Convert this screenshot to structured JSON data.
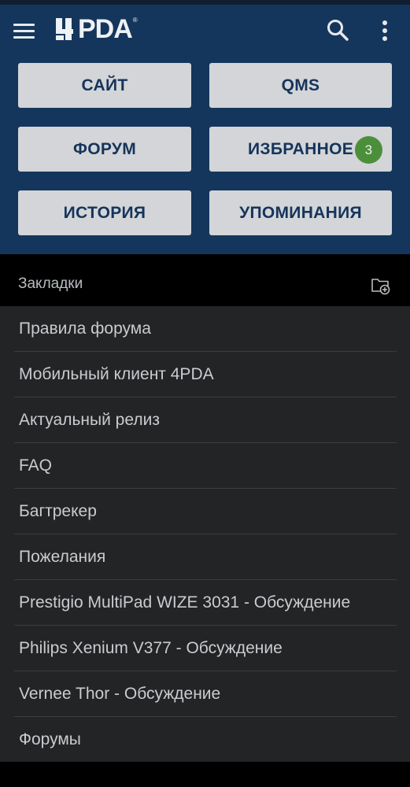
{
  "appbar": {
    "logo_text": "PDA",
    "logo_reg": "®",
    "icons": {
      "menu": "hamburger-menu-icon",
      "search": "search-icon",
      "more": "more-vert-icon"
    }
  },
  "nav": {
    "site": "САЙТ",
    "qms": "QMS",
    "forum": "ФОРУМ",
    "favorites": "ИЗБРАННОЕ",
    "favorites_badge": "3",
    "history": "ИСТОРИЯ",
    "mentions": "УПОМИНАНИЯ"
  },
  "bookmarks": {
    "title": "Закладки",
    "items": [
      "Правила форума",
      "Мобильный клиент 4PDA",
      "Актуальный релиз",
      "FAQ",
      "Багтрекер",
      "Пожелания",
      "Prestigio MultiPad WIZE 3031 - Обсуждение",
      "Philips Xenium V377 - Обсуждение",
      "Vernee Thor - Обсуждение",
      "Форумы"
    ]
  },
  "colors": {
    "header_bg": "#15365c",
    "button_bg": "#d3d5d8",
    "button_text": "#16345a",
    "badge_bg": "#4c8f3b",
    "list_bg": "#232425"
  }
}
